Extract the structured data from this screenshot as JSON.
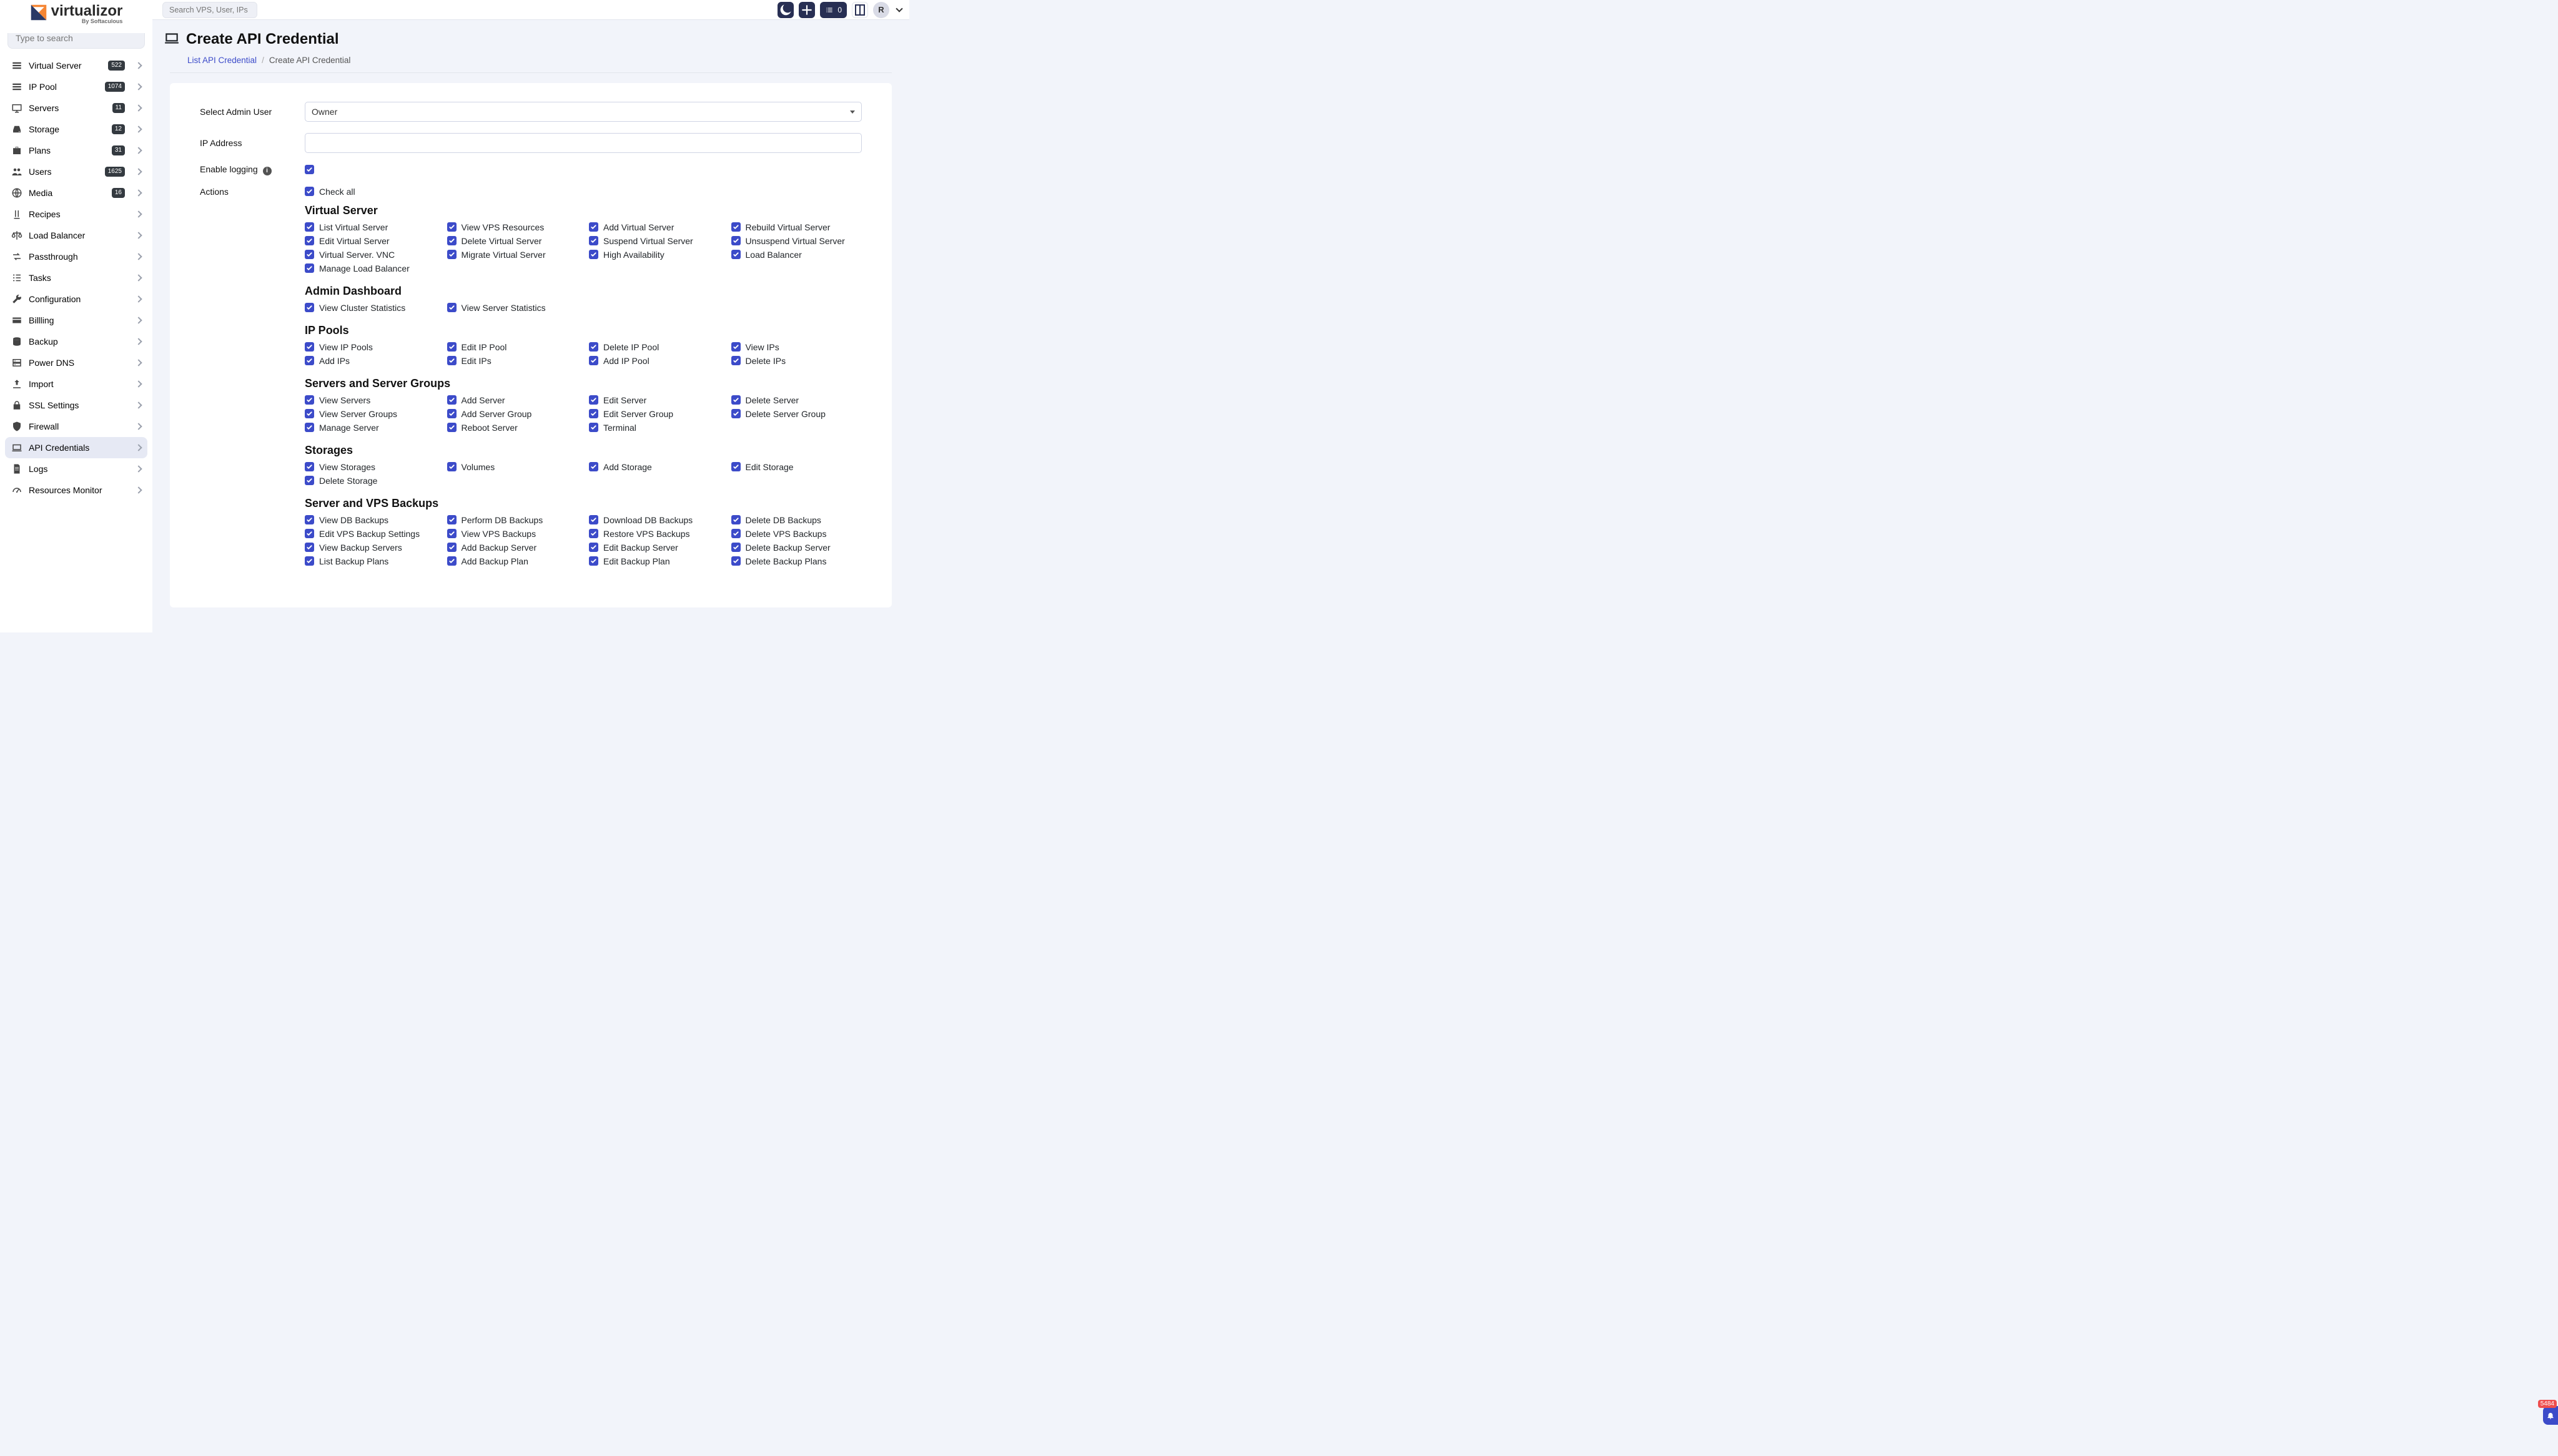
{
  "topbar": {
    "search_placeholder": "Search VPS, User, IPs",
    "task_count": "0",
    "avatar_initial": "R"
  },
  "logo": {
    "name": "virtualizor",
    "sub": "By Softaculous"
  },
  "sidebar": {
    "type_search_placeholder": "Type to search",
    "items": [
      {
        "label": "Virtual Server",
        "badge": "522",
        "icon": "server-icon"
      },
      {
        "label": "IP Pool",
        "badge": "1074",
        "icon": "ippool-icon"
      },
      {
        "label": "Servers",
        "badge": "11",
        "icon": "servers-icon"
      },
      {
        "label": "Storage",
        "badge": "12",
        "icon": "storage-icon"
      },
      {
        "label": "Plans",
        "badge": "31",
        "icon": "plans-icon"
      },
      {
        "label": "Users",
        "badge": "1625",
        "icon": "users-icon"
      },
      {
        "label": "Media",
        "badge": "16",
        "icon": "media-icon"
      },
      {
        "label": "Recipes",
        "badge": "",
        "icon": "recipes-icon"
      },
      {
        "label": "Load Balancer",
        "badge": "",
        "icon": "loadbalancer-icon"
      },
      {
        "label": "Passthrough",
        "badge": "",
        "icon": "passthrough-icon"
      },
      {
        "label": "Tasks",
        "badge": "",
        "icon": "tasks-icon"
      },
      {
        "label": "Configuration",
        "badge": "",
        "icon": "config-icon"
      },
      {
        "label": "Billling",
        "badge": "",
        "icon": "billing-icon"
      },
      {
        "label": "Backup",
        "badge": "",
        "icon": "backup-icon"
      },
      {
        "label": "Power DNS",
        "badge": "",
        "icon": "dns-icon"
      },
      {
        "label": "Import",
        "badge": "",
        "icon": "import-icon"
      },
      {
        "label": "SSL Settings",
        "badge": "",
        "icon": "ssl-icon"
      },
      {
        "label": "Firewall",
        "badge": "",
        "icon": "firewall-icon"
      },
      {
        "label": "API Credentials",
        "badge": "",
        "icon": "api-icon",
        "active": true
      },
      {
        "label": "Logs",
        "badge": "",
        "icon": "logs-icon"
      },
      {
        "label": "Resources Monitor",
        "badge": "",
        "icon": "monitor-icon"
      }
    ]
  },
  "page": {
    "title": "Create API Credential",
    "breadcrumb": {
      "link": "List API Credential",
      "current": "Create API Credential"
    }
  },
  "form": {
    "select_admin_label": "Select Admin User",
    "select_admin_value": "Owner",
    "ip_address_label": "IP Address",
    "ip_address_value": "",
    "enable_logging_label": "Enable logging",
    "actions_label": "Actions",
    "check_all_label": "Check all"
  },
  "perm_sections": [
    {
      "title": "Virtual Server",
      "perms": [
        "List Virtual Server",
        "View VPS Resources",
        "Add Virtual Server",
        "Rebuild Virtual Server",
        "Edit Virtual Server",
        "Delete Virtual Server",
        "Suspend Virtual Server",
        "Unsuspend Virtual Server",
        "Virtual Server. VNC",
        "Migrate Virtual Server",
        "High Availability",
        "Load Balancer",
        "Manage Load Balancer"
      ]
    },
    {
      "title": "Admin Dashboard",
      "perms": [
        "View Cluster Statistics",
        "View Server Statistics"
      ]
    },
    {
      "title": "IP Pools",
      "perms": [
        "View IP Pools",
        "Edit IP Pool",
        "Delete IP Pool",
        "View IPs",
        "Add IPs",
        "Edit IPs",
        "Add IP Pool",
        "Delete IPs"
      ]
    },
    {
      "title": "Servers and Server Groups",
      "perms": [
        "View Servers",
        "Add Server",
        "Edit Server",
        "Delete Server",
        "View Server Groups",
        "Add Server Group",
        "Edit Server Group",
        "Delete Server Group",
        "Manage Server",
        "Reboot Server",
        "Terminal"
      ]
    },
    {
      "title": "Storages",
      "perms": [
        "View Storages",
        "Volumes",
        "Add Storage",
        "Edit Storage",
        "Delete Storage"
      ]
    },
    {
      "title": "Server and VPS Backups",
      "perms": [
        "View DB Backups",
        "Perform DB Backups",
        "Download DB Backups",
        "Delete DB Backups",
        "Edit VPS Backup Settings",
        "View VPS Backups",
        "Restore VPS Backups",
        "Delete VPS Backups",
        "View Backup Servers",
        "Add Backup Server",
        "Edit Backup Server",
        "Delete Backup Server",
        "List Backup Plans",
        "Add Backup Plan",
        "Edit Backup Plan",
        "Delete Backup Plans"
      ]
    }
  ],
  "notification": {
    "count": "5484"
  }
}
